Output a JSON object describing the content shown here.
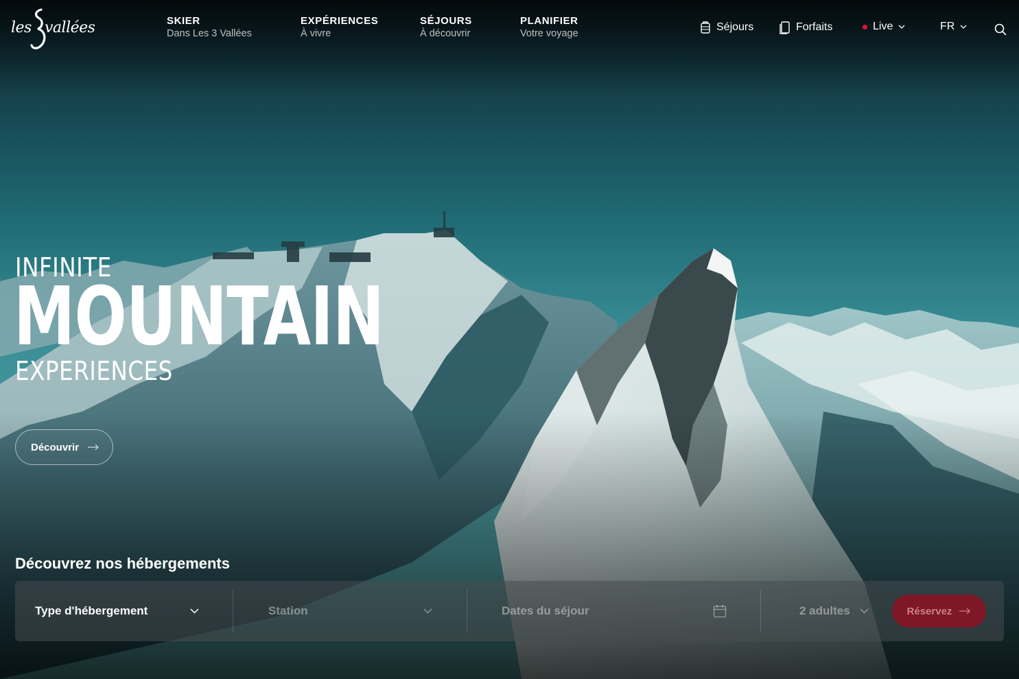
{
  "brand": {
    "logo_prefix": "les",
    "logo_numeral": "3",
    "logo_suffix": "vallées"
  },
  "nav": [
    {
      "title": "SKIER",
      "subtitle": "Dans Les 3 Vallées"
    },
    {
      "title": "EXPÉRIENCES",
      "subtitle": "À vivre"
    },
    {
      "title": "SÉJOURS",
      "subtitle": "À découvrir"
    },
    {
      "title": "PLANIFIER",
      "subtitle": "Votre voyage"
    }
  ],
  "utility": {
    "sejours": "Séjours",
    "forfaits": "Forfaits",
    "live": "Live",
    "language": "FR"
  },
  "hero": {
    "line1": "INFINITE",
    "line2": "MOUNTAIN",
    "line3": "EXPERIENCES",
    "cta": "Découvrir"
  },
  "booking": {
    "title": "Découvrez nos hébergements",
    "type_label": "Type d'hébergement",
    "station_label": "Station",
    "dates_label": "Dates du séjour",
    "guests_label": "2 adultes",
    "submit": "Réservez"
  },
  "colors": {
    "live_dot": "#e2123a",
    "reserve_button": "#7e1726",
    "reserve_text": "#c98189"
  },
  "icons": [
    "suitcase-icon",
    "ticket-icon",
    "chevron-down-icon",
    "search-icon",
    "arrow-right-icon",
    "calendar-icon"
  ]
}
